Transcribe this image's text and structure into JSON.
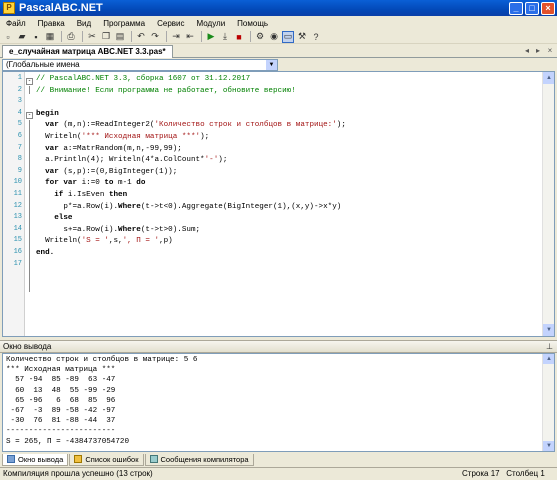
{
  "window": {
    "title": "PascalABC.NET"
  },
  "menu": [
    "Файл",
    "Правка",
    "Вид",
    "Программа",
    "Сервис",
    "Модули",
    "Помощь"
  ],
  "toolbar_icons": [
    "new-file-icon",
    "open-icon",
    "save-icon",
    "save-all-icon",
    "print-icon",
    "cut-icon",
    "copy-icon",
    "paste-icon",
    "undo-icon",
    "redo-icon",
    "indent-icon",
    "outdent-icon",
    "run-icon",
    "step-icon",
    "stop-icon",
    "debug-icon",
    "watch-icon",
    "output-window-icon",
    "compile-icon",
    "help-icon"
  ],
  "tab": {
    "label": "e_случайная матрица ABC.NET 3.3.pas*"
  },
  "scope": {
    "value": "(Глобальные имена"
  },
  "editor": {
    "line_numbers": [
      "1",
      "2",
      "3",
      "4",
      "5",
      "6",
      "7",
      "8",
      "9",
      "10",
      "11",
      "12",
      "13",
      "14",
      "15",
      "16",
      "17"
    ],
    "lines": [
      [
        {
          "t": "// PascalABC.NET 3.3, сборка 1607 от 31.12.2017",
          "c": "cm"
        }
      ],
      [
        {
          "t": "// Внимание! Если программа не работает, обновите версию!",
          "c": "cm"
        }
      ],
      [
        {
          "t": "",
          "c": ""
        }
      ],
      [
        {
          "t": "begin",
          "c": "kw"
        }
      ],
      [
        {
          "t": "  ",
          "c": ""
        },
        {
          "t": "var",
          "c": "kw"
        },
        {
          "t": " (m,n):=ReadInteger2(",
          "c": ""
        },
        {
          "t": "'Количество строк и столбцов в матрице:'",
          "c": "st"
        },
        {
          "t": ");",
          "c": ""
        }
      ],
      [
        {
          "t": "  Writeln(",
          "c": ""
        },
        {
          "t": "'*** Исходная матрица ***'",
          "c": "st"
        },
        {
          "t": ");",
          "c": ""
        }
      ],
      [
        {
          "t": "  ",
          "c": ""
        },
        {
          "t": "var",
          "c": "kw"
        },
        {
          "t": " a:=MatrRandom(m,n,-99,99);",
          "c": ""
        }
      ],
      [
        {
          "t": "  a.Println(4); Writeln(4*a.ColCount*",
          "c": ""
        },
        {
          "t": "'-'",
          "c": "st"
        },
        {
          "t": ");",
          "c": ""
        }
      ],
      [
        {
          "t": "  ",
          "c": ""
        },
        {
          "t": "var",
          "c": "kw"
        },
        {
          "t": " (s,p):=(0,BigInteger(1));",
          "c": ""
        }
      ],
      [
        {
          "t": "  ",
          "c": ""
        },
        {
          "t": "for var",
          "c": "kw"
        },
        {
          "t": " i:=0 ",
          "c": ""
        },
        {
          "t": "to",
          "c": "kw"
        },
        {
          "t": " m-1 ",
          "c": ""
        },
        {
          "t": "do",
          "c": "kw"
        }
      ],
      [
        {
          "t": "    ",
          "c": ""
        },
        {
          "t": "if",
          "c": "kw"
        },
        {
          "t": " i.IsEven ",
          "c": ""
        },
        {
          "t": "then",
          "c": "kw"
        }
      ],
      [
        {
          "t": "      p*=a.Row(i).",
          "c": ""
        },
        {
          "t": "Where",
          "c": "kw"
        },
        {
          "t": "(t->t<0).Aggregate(BigInteger(1),(x,y)->x*y)",
          "c": ""
        }
      ],
      [
        {
          "t": "    ",
          "c": ""
        },
        {
          "t": "else",
          "c": "kw"
        }
      ],
      [
        {
          "t": "      s+=a.Row(i).",
          "c": ""
        },
        {
          "t": "Where",
          "c": "kw"
        },
        {
          "t": "(t->t>0).Sum;",
          "c": ""
        }
      ],
      [
        {
          "t": "  Writeln(",
          "c": ""
        },
        {
          "t": "'S = '",
          "c": "st"
        },
        {
          "t": ",s,",
          "c": ""
        },
        {
          "t": "', П = '",
          "c": "st"
        },
        {
          "t": ",p)",
          "c": ""
        }
      ],
      [
        {
          "t": "end.",
          "c": "kw"
        }
      ],
      [
        {
          "t": "",
          "c": ""
        }
      ]
    ]
  },
  "output_panel": {
    "header": "Окно вывода",
    "lines": [
      "Количество строк и столбцов в матрице: 5 6",
      "*** Исходная матрица ***",
      "  57 -94  85 -89  63 -47",
      "  60  13  48  55 -99 -29",
      "  65 -96   6  68  85  96",
      " -67  -3  89 -58 -42 -97",
      " -30  76  81 -88 -44  37",
      "------------------------",
      "S = 265, П = -4384737054720"
    ]
  },
  "bottom_tabs": [
    "Окно вывода",
    "Список ошибок",
    "Сообщения компилятора"
  ],
  "status": {
    "message": "Компиляция прошла успешно (13 строк)",
    "row_label": "Строка",
    "row": "17",
    "col_label": "Столбец",
    "col": "1"
  }
}
